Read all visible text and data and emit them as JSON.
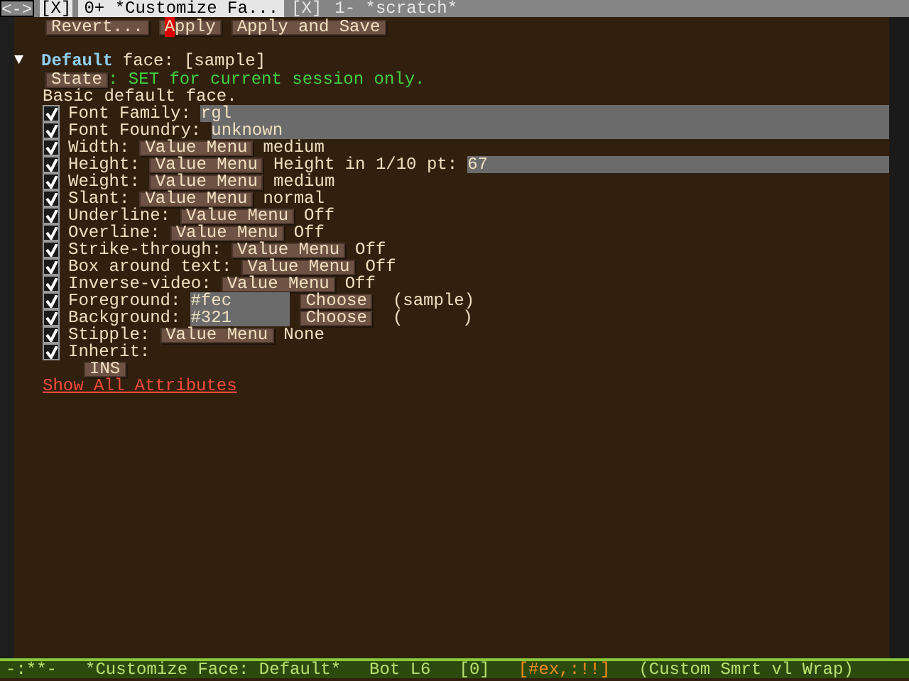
{
  "tab_bar": [
    {
      "label": "<->",
      "kind": "nav",
      "selected": false
    },
    {
      "label": "[X]",
      "kind": "close",
      "selected": true
    },
    {
      "label": "0+ *Customize Fa...",
      "kind": "tab",
      "selected": true
    },
    {
      "label": "[X]",
      "kind": "close",
      "selected": false
    },
    {
      "label": "1- *scratch*",
      "kind": "tab",
      "selected": false
    }
  ],
  "toolbar": [
    {
      "label": "Revert...",
      "cursor": false
    },
    {
      "label": "Apply",
      "cursor": true
    },
    {
      "label": "Apply and Save",
      "cursor": false
    }
  ],
  "face": {
    "expanded": true,
    "toggle": "▼",
    "name": "Default",
    "label": "face:",
    "sample": "[sample]"
  },
  "state": {
    "button": "State",
    "message": ": SET for current session only."
  },
  "doc": "Basic default face.",
  "attributes": [
    {
      "kind": "text",
      "checked": true,
      "label": "Font Family:",
      "value": "rgl"
    },
    {
      "kind": "text",
      "checked": true,
      "label": "Font Foundry:",
      "value": "unknown"
    },
    {
      "kind": "menu",
      "checked": true,
      "label": "Width:",
      "button": "Value Menu",
      "value": "medium"
    },
    {
      "kind": "height",
      "checked": true,
      "label": "Height:",
      "button": "Value Menu",
      "extra": "Height in 1/10 pt:",
      "value": "67"
    },
    {
      "kind": "menu",
      "checked": true,
      "label": "Weight:",
      "button": "Value Menu",
      "value": "medium"
    },
    {
      "kind": "menu",
      "checked": true,
      "label": "Slant:",
      "button": "Value Menu",
      "value": "normal"
    },
    {
      "kind": "menu",
      "checked": true,
      "label": "Underline:",
      "button": "Value Menu",
      "value": "Off"
    },
    {
      "kind": "menu",
      "checked": true,
      "label": "Overline:",
      "button": "Value Menu",
      "value": "Off"
    },
    {
      "kind": "menu",
      "checked": true,
      "label": "Strike-through:",
      "button": "Value Menu",
      "value": "Off"
    },
    {
      "kind": "menu",
      "checked": true,
      "label": "Box around text:",
      "button": "Value Menu",
      "value": "Off"
    },
    {
      "kind": "menu",
      "checked": true,
      "label": "Inverse-video:",
      "button": "Value Menu",
      "value": "Off"
    },
    {
      "kind": "color",
      "checked": true,
      "label": "Foreground:",
      "value": "#fec",
      "button": "Choose",
      "sample_open": "(sample)"
    },
    {
      "kind": "color",
      "checked": true,
      "label": "Background:",
      "value": "#321",
      "button": "Choose",
      "sample_left": "(",
      "sample_right": ")"
    },
    {
      "kind": "menu",
      "checked": true,
      "label": "Stipple:",
      "button": "Value Menu",
      "value": "None"
    },
    {
      "kind": "plain",
      "checked": true,
      "label": "Inherit:"
    }
  ],
  "ins_button": "INS",
  "link": "Show All Attributes",
  "status_bar": [
    {
      "text": "-:**-",
      "kind": "normal"
    },
    {
      "text": "*Customize Face: Default*",
      "kind": "normal"
    },
    {
      "text": "Bot L6",
      "kind": "normal"
    },
    {
      "text": "[0]",
      "kind": "normal"
    },
    {
      "text": "[#ex,:!!]",
      "kind": "warn"
    },
    {
      "text": "(Custom Smrt vl Wrap)",
      "kind": "normal"
    }
  ]
}
